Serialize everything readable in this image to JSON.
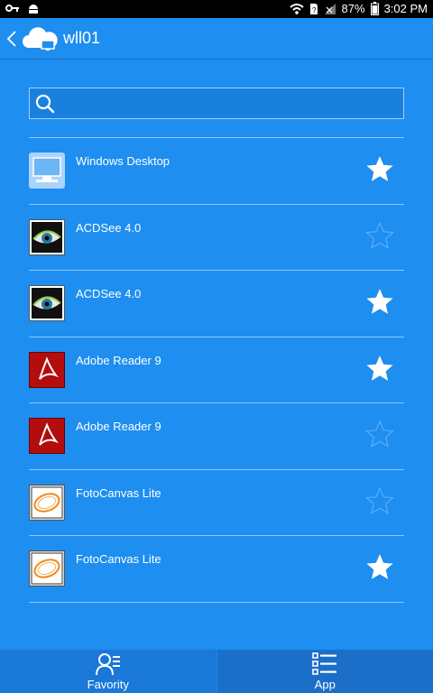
{
  "status_bar": {
    "battery": "87%",
    "time": "3:02 PM"
  },
  "header": {
    "title": "wll01"
  },
  "search": {
    "placeholder": "",
    "value": ""
  },
  "apps": [
    {
      "name": "Windows Desktop",
      "icon": "monitor-icon",
      "favorite": true
    },
    {
      "name": "ACDSee 4.0",
      "icon": "acdsee-eye-icon",
      "favorite": false
    },
    {
      "name": "ACDSee 4.0",
      "icon": "acdsee-eye-icon",
      "favorite": true
    },
    {
      "name": "Adobe Reader 9",
      "icon": "adobe-reader-icon",
      "favorite": true
    },
    {
      "name": "Adobe Reader 9",
      "icon": "adobe-reader-icon",
      "favorite": false
    },
    {
      "name": "FotoCanvas Lite",
      "icon": "fotocanvas-icon",
      "favorite": false
    },
    {
      "name": "FotoCanvas Lite",
      "icon": "fotocanvas-icon",
      "favorite": true
    }
  ],
  "bottom_nav": {
    "favorites_label": "Favority",
    "apps_label": "App"
  },
  "colors": {
    "background": "#1e8ef0",
    "divider": "#8fc7fb",
    "star_filled": "#ffffff",
    "star_outline": "#5ab0ff"
  }
}
